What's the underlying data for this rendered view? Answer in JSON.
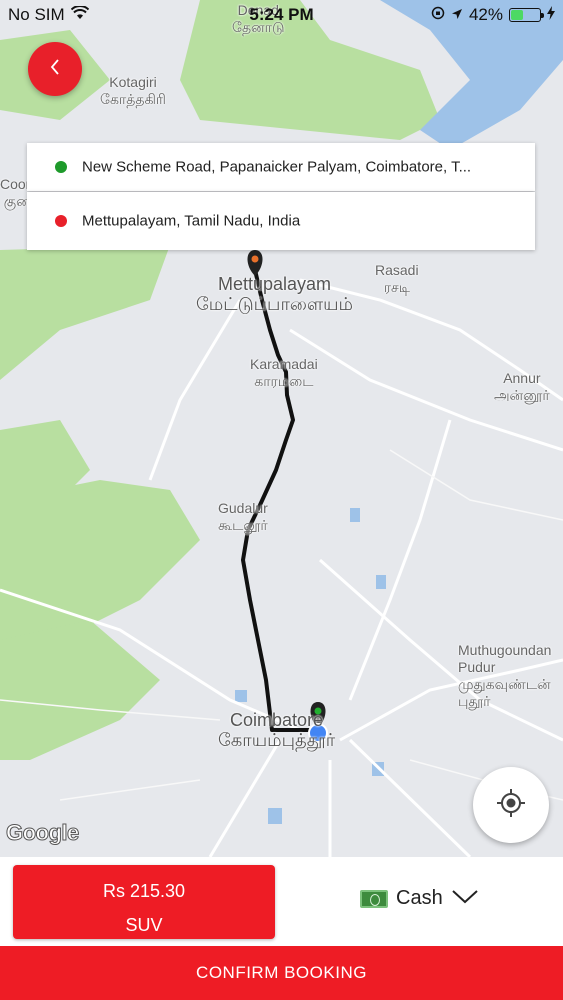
{
  "status_bar": {
    "carrier": "No SIM",
    "time": "5:24 PM",
    "battery_pct": "42%",
    "battery_level": 0.42
  },
  "trip": {
    "pickup": "New Scheme Road, Papanaicker Palyam, Coimbatore, T...",
    "drop": "Mettupalayam, Tamil Nadu, India",
    "pickup_color": "#1e9a2b",
    "drop_color": "#e8202a"
  },
  "map": {
    "labels": {
      "denad": "Denad",
      "denad_ta": "தேனாடு",
      "kotagiri": "Kotagiri",
      "kotagiri_ta": "கோத்தகிரி",
      "coon": "Coon",
      "coon_ta": "குன",
      "mettupalayam": "Mettupalayam",
      "mettupalayam_ta": "மேட்டுப்பாளையம்",
      "rasadi": "Rasadi",
      "rasadi_ta": "ரசடி",
      "karamadai": "Karamadai",
      "karamadai_ta": "காரமடை",
      "annur": "Annur",
      "annur_ta": "அன்னூர்",
      "gudalur": "Gudalur",
      "gudalur_ta": "கூடலூர்",
      "muthugoundan": "Muthugoundan",
      "pudur": "Pudur",
      "muthugoundan_ta": "முதுகவுண்டன்",
      "pudur_ta": "புதூர்",
      "coimbatore": "Coimbatore",
      "coimbatore_ta": "கோயம்புத்தூர்"
    },
    "attribution": "Google"
  },
  "booking": {
    "fare": "Rs  215.30",
    "vehicle": "SUV",
    "payment_method": "Cash",
    "confirm_label": "CONFIRM BOOKING"
  },
  "icons": {
    "back": "chevron-left-icon",
    "locate": "crosshair-icon",
    "payment": "cash-icon",
    "dropdown": "chevron-down-icon"
  },
  "colors": {
    "accent": "#ee1c25",
    "route": "#111111",
    "current_location": "#4285f4"
  }
}
